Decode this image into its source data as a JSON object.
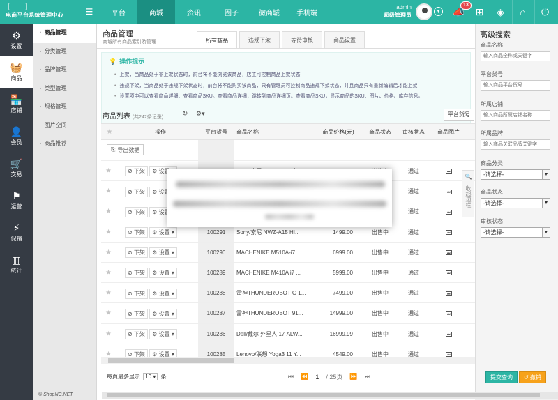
{
  "brand": {
    "title": "电商平台系统管理中心"
  },
  "topnav": [
    {
      "label": "平台",
      "active": false
    },
    {
      "label": "商城",
      "active": true
    },
    {
      "label": "资讯",
      "active": false
    },
    {
      "label": "圈子",
      "active": false
    },
    {
      "label": "微商城",
      "active": false
    },
    {
      "label": "手机端",
      "active": false
    }
  ],
  "user": {
    "name": "admin",
    "role": "超级管理员"
  },
  "notifications": {
    "count": "13"
  },
  "iconbar": [
    {
      "label": "设置",
      "icon": "gear-icon",
      "glyph": "⚙",
      "active": false
    },
    {
      "label": "商品",
      "icon": "basket-icon",
      "glyph": "🧺",
      "active": true
    },
    {
      "label": "店铺",
      "icon": "store-icon",
      "glyph": "🏪",
      "active": false
    },
    {
      "label": "会员",
      "icon": "user-icon",
      "glyph": "👤",
      "active": false
    },
    {
      "label": "交易",
      "icon": "cart-icon",
      "glyph": "🛒",
      "active": false
    },
    {
      "label": "运营",
      "icon": "ops-icon",
      "glyph": "⚑",
      "active": false
    },
    {
      "label": "促销",
      "icon": "promo-icon",
      "glyph": "⚡",
      "active": false
    },
    {
      "label": "统计",
      "icon": "stats-icon",
      "glyph": "▥",
      "active": false
    }
  ],
  "subnav": [
    {
      "label": "商品管理",
      "active": true
    },
    {
      "label": "分类管理",
      "active": false
    },
    {
      "label": "品牌管理",
      "active": false
    },
    {
      "label": "类型管理",
      "active": false
    },
    {
      "label": "规格管理",
      "active": false
    },
    {
      "label": "图片空间",
      "active": false
    },
    {
      "label": "商品推荐",
      "active": false
    }
  ],
  "page": {
    "title": "商品管理",
    "subtitle": "商城所有商品索引及管理",
    "tabs": [
      {
        "label": "所有商品",
        "active": true
      },
      {
        "label": "违规下架",
        "active": false
      },
      {
        "label": "等待审核",
        "active": false
      },
      {
        "label": "商品设置",
        "active": false
      }
    ]
  },
  "tips": {
    "title": "操作提示",
    "items": [
      "上架，当商品处于非上架状态时，前台将不能浏览该商品，店主可控制商品上架状态",
      "违规下架，当商品处于违规下架状态时，前台将不能购买该商品，只有管理员可控制商品违规下架状态，并且商品只有重新编辑后才能上架",
      "设置项中可以查看商品详细、查看商品SKU。查看商品详细，跳转到商品详细页。查看商品SKU，显示商品的SKU、图片、价格、库存信息。"
    ]
  },
  "list": {
    "title": "商品列表",
    "count": "(共242条记录)",
    "platform_btn": "平台货号",
    "export_label": "导出数据",
    "headers": [
      "操作",
      "平台货号",
      "商品名称",
      "商品价格(元)",
      "商品状态",
      "审核状态",
      "商品图片"
    ],
    "action_off": "下架",
    "action_set": "设置",
    "rows": [
      {
        "id": "100294",
        "name": "Sony/索尼 ILCE-5000L标...",
        "price": "2899.00",
        "status": "出售中",
        "audit": "通过"
      },
      {
        "id": "100293",
        "name": "",
        "price": "",
        "status": "出售中",
        "audit": "通过"
      },
      {
        "id": "100292",
        "name": "Sony/...",
        "price": "9699.00",
        "status": "出售中",
        "audit": "通过"
      },
      {
        "id": "100291",
        "name": "Sony/索尼 NWZ-A15 HI...",
        "price": "1499.00",
        "status": "出售中",
        "audit": "通过"
      },
      {
        "id": "100290",
        "name": "MACHENIKE M510A-i7 ...",
        "price": "6999.00",
        "status": "出售中",
        "audit": "通过"
      },
      {
        "id": "100289",
        "name": "MACHENIKE M410A i7 ...",
        "price": "5999.00",
        "status": "出售中",
        "audit": "通过"
      },
      {
        "id": "100288",
        "name": "雷神THUNDEROBOT G 1...",
        "price": "7499.00",
        "status": "出售中",
        "audit": "通过"
      },
      {
        "id": "100287",
        "name": "雷神THUNDEROBOT 91...",
        "price": "14999.00",
        "status": "出售中",
        "audit": "通过"
      },
      {
        "id": "100286",
        "name": "Dell/戴尔 外星人 17 ALW...",
        "price": "16999.99",
        "status": "出售中",
        "audit": "通过"
      },
      {
        "id": "100285",
        "name": "Lenovo/联想 Yoga3 11 Y...",
        "price": "4549.00",
        "status": "出售中",
        "audit": "通过"
      }
    ]
  },
  "pagination": {
    "per_page_label": "每页最多显示",
    "per_page": "10",
    "unit": "条",
    "current": "1",
    "total": "/ 25页"
  },
  "collapse_label": "收起边栏",
  "advanced": {
    "title": "高级搜索",
    "fields": [
      {
        "label": "商品名称",
        "placeholder": "输入商品全称或关键字"
      },
      {
        "label": "平台货号",
        "placeholder": "输入商品平台货号"
      },
      {
        "label": "所属店铺",
        "placeholder": "输入商品所属店铺名称"
      },
      {
        "label": "所属品牌",
        "placeholder": "输入商品关联品牌关键字"
      }
    ],
    "selects": [
      {
        "label": "商品分类",
        "value": "-请选择-"
      },
      {
        "label": "商品状态",
        "value": "-请选择-"
      },
      {
        "label": "审核状态",
        "value": "-请选择-"
      }
    ],
    "submit": "提交查询",
    "reset": "撤销"
  },
  "copyright": "© ShopNC.NET",
  "colors": {
    "accent": "#2cb5a4",
    "sidebar": "#353b44",
    "reset": "#f7a21b",
    "badge": "#e5484d"
  }
}
